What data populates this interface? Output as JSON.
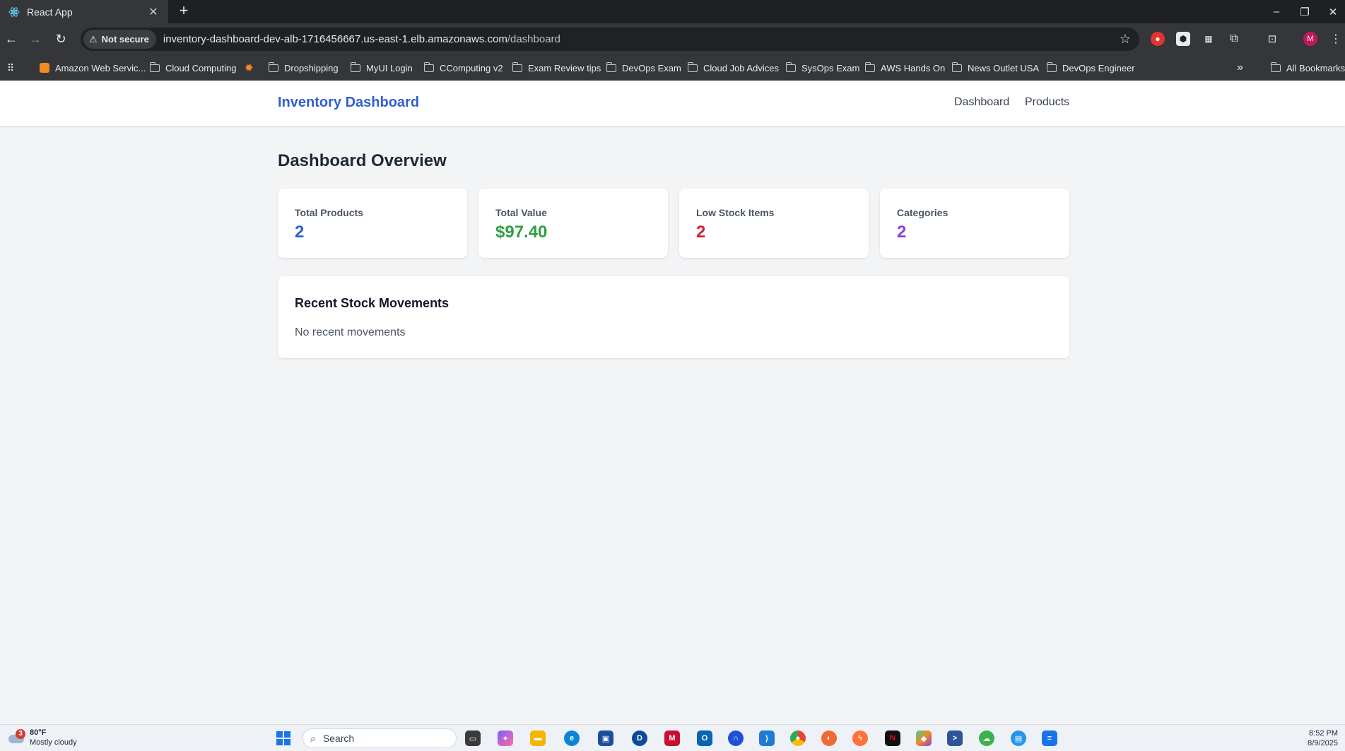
{
  "browser": {
    "tab_title": "React App",
    "tab_close": "✕",
    "new_tab": "+",
    "security_label": "Not secure",
    "url_host": "inventory-dashboard-dev-alb-1716456667.us-east-1.elb.amazonaws.com",
    "url_path": "/dashboard",
    "profile_initial": "M",
    "bookmarks": [
      "Amazon Web Servic...",
      "Cloud Computing",
      "Dropshipping",
      "MyUI Login",
      "CComputing v2",
      "Exam Review tips",
      "DevOps Exam",
      "Cloud Job Advices",
      "SysOps Exam",
      "AWS Hands On",
      "News Outlet USA",
      "DevOps Engineer"
    ],
    "bookmarks_overflow": "»",
    "all_bookmarks": "All Bookmarks"
  },
  "app": {
    "brand": "Inventory Dashboard",
    "nav": {
      "dashboard": "Dashboard",
      "products": "Products"
    },
    "page_title": "Dashboard Overview",
    "stats": [
      {
        "label": "Total Products",
        "value": "2",
        "color": "#2f5fd0"
      },
      {
        "label": "Total Value",
        "value": "$97.40",
        "color": "#2f9e44"
      },
      {
        "label": "Low Stock Items",
        "value": "2",
        "color": "#d0213a"
      },
      {
        "label": "Categories",
        "value": "2",
        "color": "#8a3fe0"
      }
    ],
    "recent": {
      "title": "Recent Stock Movements",
      "empty": "No recent movements"
    }
  },
  "taskbar": {
    "weather_badge": "3",
    "temperature": "80°F",
    "condition": "Mostly cloudy",
    "search_placeholder": "Search",
    "time": "8:52 PM",
    "date": "8/9/2025"
  }
}
